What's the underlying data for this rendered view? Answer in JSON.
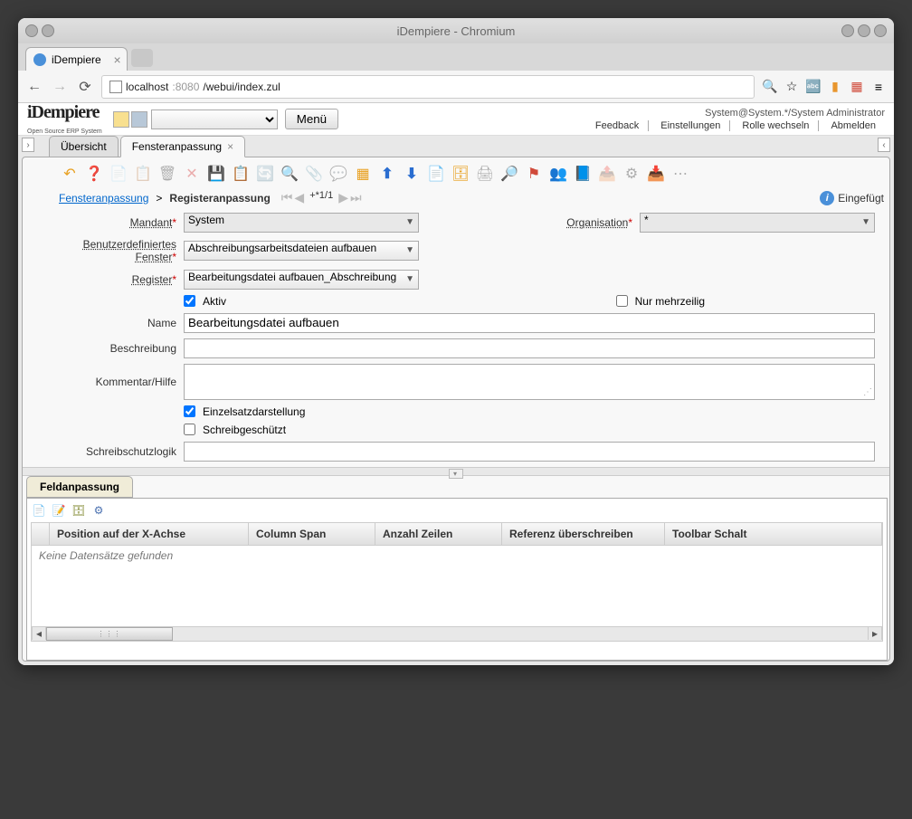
{
  "window": {
    "title": "iDempiere - Chromium"
  },
  "browser": {
    "tab_title": "iDempiere",
    "url_host": "localhost",
    "url_port": ":8080",
    "url_path": "/webui/index.zul"
  },
  "header": {
    "logo": "iDempiere",
    "logo_sub": "Open Source ERP System",
    "menu_btn": "Menü",
    "user_info": "System@System.*/System Administrator",
    "links": {
      "feedback": "Feedback",
      "settings": "Einstellungen",
      "change_role": "Rolle wechseln",
      "logout": "Abmelden"
    }
  },
  "tabs": {
    "overview": "Übersicht",
    "active": "Fensteranpassung"
  },
  "breadcrumb": {
    "link": "Fensteranpassung",
    "sep": ">",
    "current": "Registeranpassung",
    "page": "+*1/1",
    "status": "Eingefügt"
  },
  "form": {
    "mandant_label": "Mandant",
    "mandant_value": "System",
    "organisation_label": "Organisation",
    "organisation_value": "*",
    "fenster_label": "Benutzerdefiniertes Fenster",
    "fenster_value": "Abschreibungsarbeitsdateien aufbauen",
    "register_label": "Register",
    "register_value": "Bearbeitungsdatei aufbauen_Abschreibung",
    "aktiv_label": "Aktiv",
    "mehrzeilig_label": "Nur mehrzeilig",
    "name_label": "Name",
    "name_value": "Bearbeitungsdatei aufbauen",
    "beschreibung_label": "Beschreibung",
    "kommentar_label": "Kommentar/Hilfe",
    "einzelsatz_label": "Einzelsatzdarstellung",
    "schreibgesch_label": "Schreibgeschützt",
    "schreibschutz_label": "Schreibschutzlogik"
  },
  "subtab": {
    "title": "Feldanpassung",
    "cols": {
      "c1": "Position auf der X-Achse",
      "c2": "Column Span",
      "c3": "Anzahl Zeilen",
      "c4": "Referenz überschreiben",
      "c5": "Toolbar Schalt"
    },
    "empty": "Keine Datensätze gefunden"
  }
}
